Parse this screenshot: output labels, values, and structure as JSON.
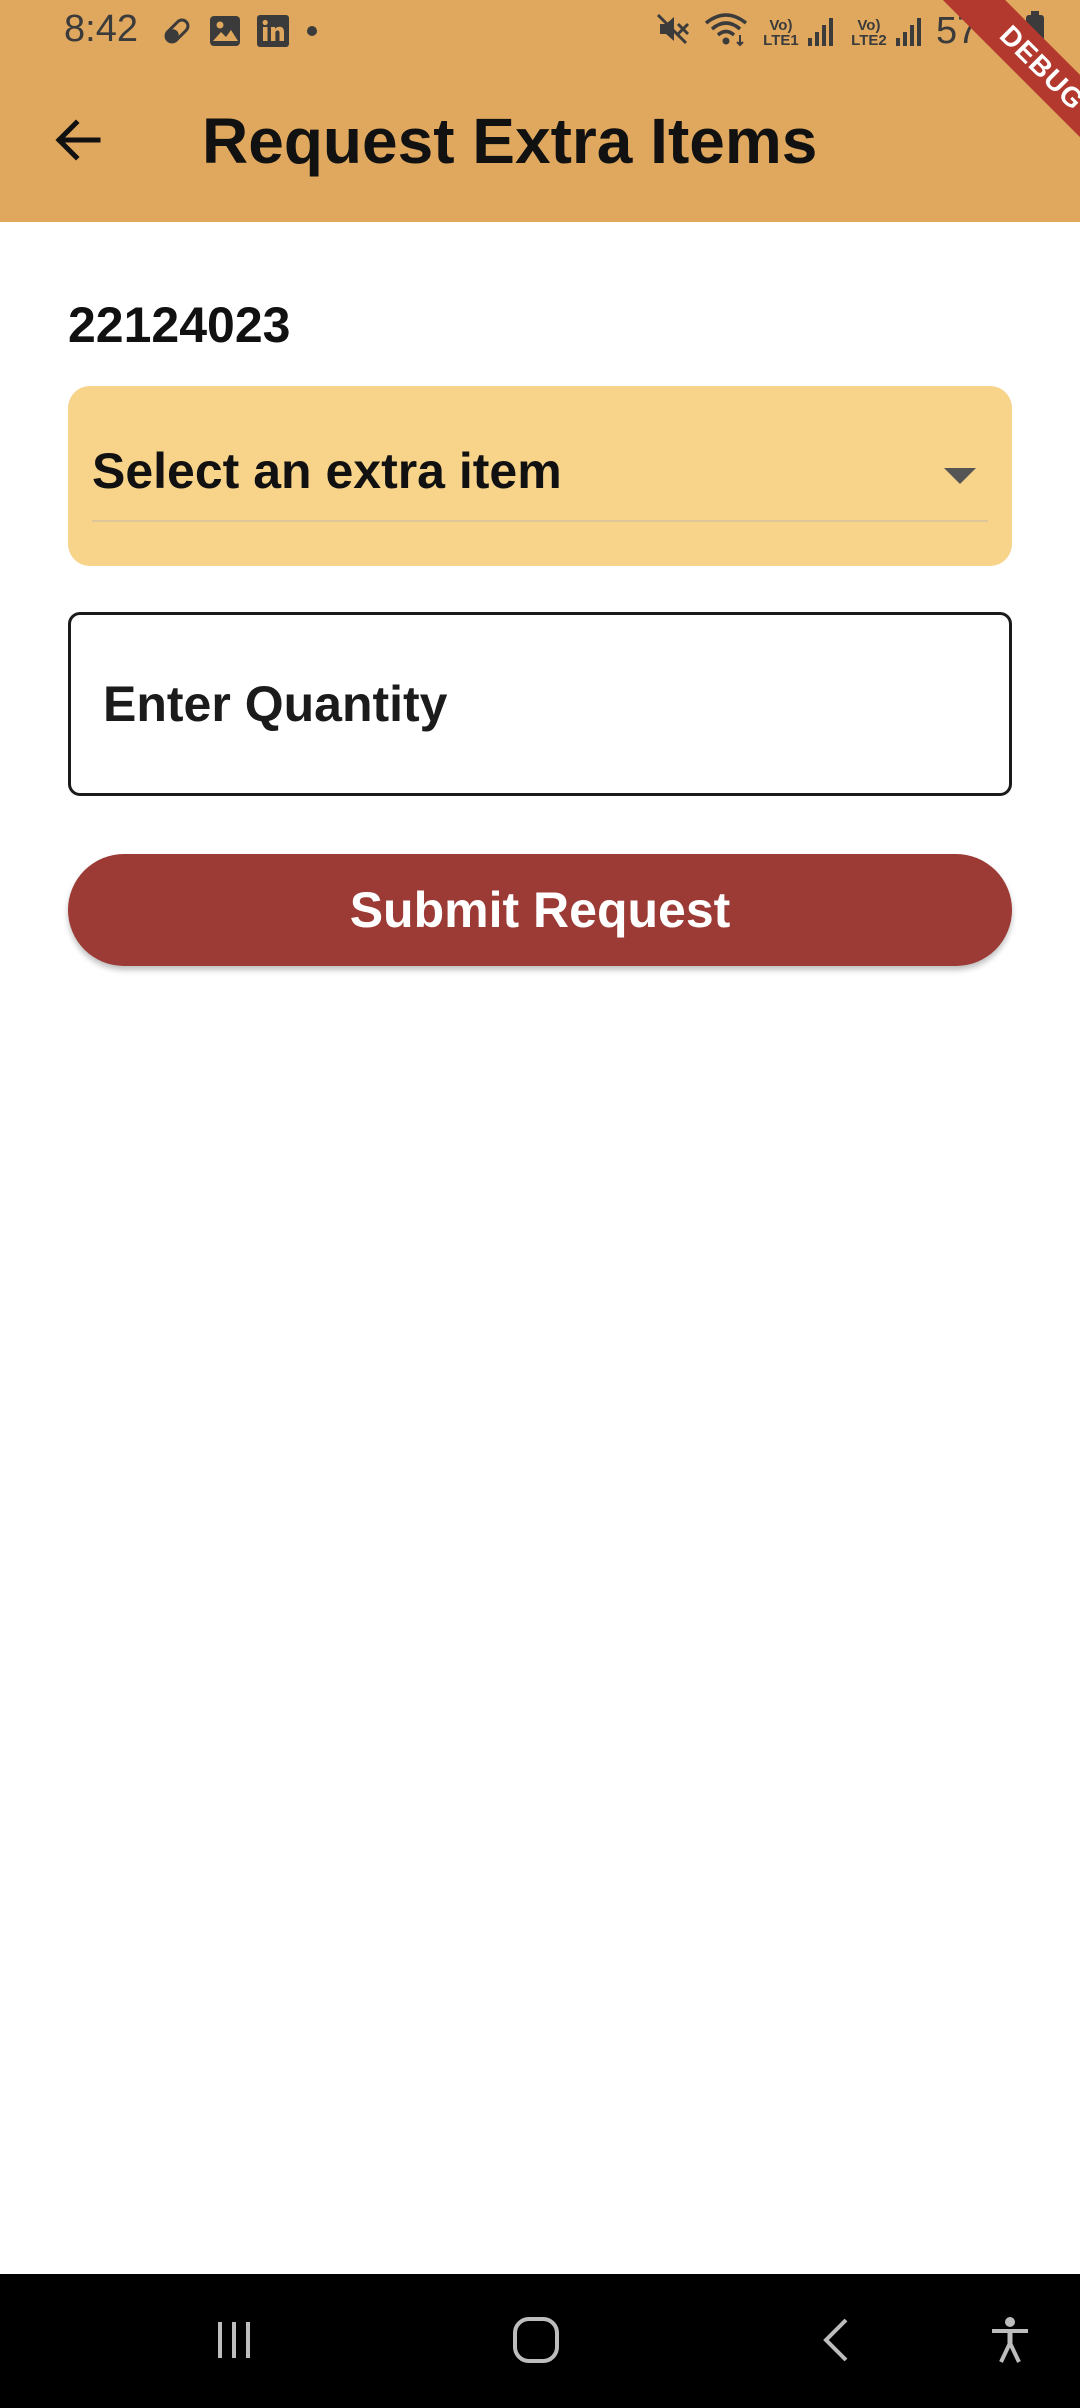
{
  "status_bar": {
    "time": "8:42",
    "battery_percent": "57%",
    "left_icons": [
      "pill-icon",
      "gallery-icon",
      "linkedin-icon",
      "dot-icon"
    ],
    "right_icons": [
      "mute-icon",
      "wifi-icon",
      "signal-lte1-icon",
      "signal-lte2-icon",
      "battery-icon"
    ],
    "sim1_label": "Vo) LTE1",
    "sim2_label": "Vo) LTE2"
  },
  "app_bar": {
    "title": "Request Extra Items",
    "back_icon": "arrow-back-icon",
    "background_color": "#dfa85e"
  },
  "debug_banner": {
    "label": "DEBUG",
    "color": "#b3382e"
  },
  "form": {
    "order_id": "22124023",
    "dropdown": {
      "selected_label": "Select an extra item",
      "background_color": "#f8d48b"
    },
    "quantity": {
      "placeholder": "Enter Quantity",
      "value": ""
    },
    "submit": {
      "label": "Submit Request",
      "color": "#9c3a35"
    }
  },
  "nav_bar": {
    "items": [
      "recents-icon",
      "home-icon",
      "back-icon",
      "accessibility-icon"
    ]
  }
}
